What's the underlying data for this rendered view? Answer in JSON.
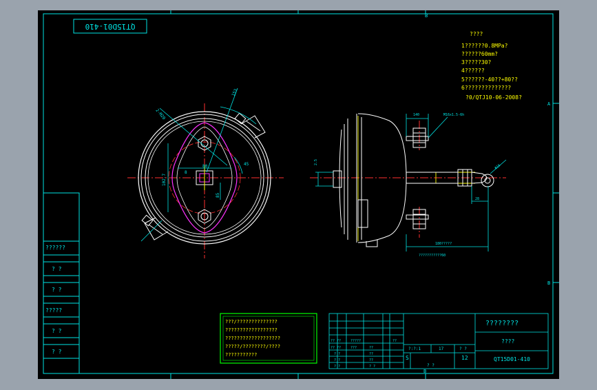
{
  "drawing_code_rotated": "QT15D01-410",
  "tech_req": {
    "heading": "????",
    "lines": [
      "1??????0.8MPa?",
      "??????60mm?",
      "3?????30?",
      "4??????",
      "5??????-40??+80??",
      "6??????????????",
      "?0/QTJ10-06-2008?"
    ]
  },
  "notes_box": {
    "lines": [
      "???/??????????????",
      "??????????????????",
      "???????????????????",
      "?????/????????/????",
      "???????????"
    ]
  },
  "title_block": {
    "company": "????????",
    "part_name": "????",
    "drawing_no": "QT15D01-410",
    "scale_label": "?:?:1",
    "sheet": "12",
    "marker": "S",
    "grid_a": [
      "?? ??",
      "?????",
      "??"
    ],
    "grid_b": [
      "?? ??",
      "??? ",
      "??"
    ],
    "rows_left": [
      "? ?",
      "? ?",
      "? ?",
      "? ?"
    ],
    "cols_mid": [
      "??",
      "??",
      "? ?",
      "? ?"
    ],
    "col_17": "17",
    "col_q": "? ?",
    "row_mid": "? ?"
  },
  "left_margin_labels": [
    "??????",
    "? ?",
    "? ?",
    "?????",
    "? ?",
    "? ?"
  ],
  "zone_labels": {
    "top_b": "B",
    "left_a": "A",
    "bottom_b": "B",
    "right_a": "A",
    "right_b": "B"
  },
  "dimensions": {
    "d1": "2-M20",
    "d2": "80",
    "d3": "102.7",
    "d4": "153",
    "d5": "45",
    "d6": "8",
    "d7": "85",
    "d8": "140",
    "d9": "M16x1.5-6h",
    "d10": "2.5",
    "d11": "28",
    "d12": "Φ16",
    "d13": "180?????",
    "d14": "???????????60"
  }
}
